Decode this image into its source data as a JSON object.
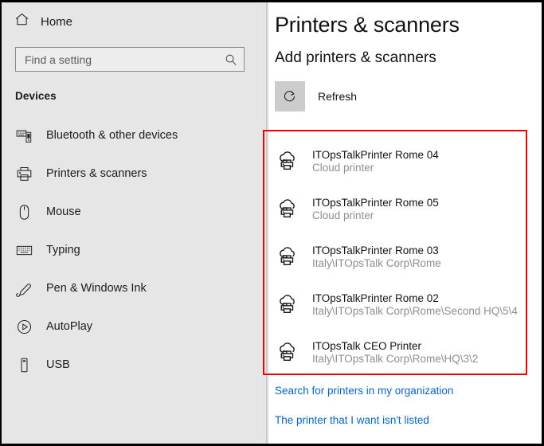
{
  "sidebar": {
    "home": {
      "label": "Home",
      "icon": "home-icon"
    },
    "search": {
      "value": "",
      "placeholder": "Find a setting",
      "icon": "search-icon"
    },
    "group_title": "Devices",
    "items": [
      {
        "label": "Bluetooth & other devices",
        "icon": "bluetooth-devices-icon"
      },
      {
        "label": "Printers & scanners",
        "icon": "printer-icon"
      },
      {
        "label": "Mouse",
        "icon": "mouse-icon"
      },
      {
        "label": "Typing",
        "icon": "keyboard-icon"
      },
      {
        "label": "Pen & Windows Ink",
        "icon": "pen-icon"
      },
      {
        "label": "AutoPlay",
        "icon": "autoplay-icon"
      },
      {
        "label": "USB",
        "icon": "usb-icon"
      }
    ]
  },
  "main": {
    "page_title": "Printers & scanners",
    "section_title": "Add printers & scanners",
    "refresh": {
      "label": "Refresh",
      "icon": "refresh-icon"
    },
    "printers": [
      {
        "name": "ITOpsTalkPrinter Rome 04",
        "sub": "Cloud printer",
        "icon": "cloud-printer-icon"
      },
      {
        "name": "ITOpsTalkPrinter Rome 05",
        "sub": "Cloud printer",
        "icon": "cloud-printer-icon"
      },
      {
        "name": "ITOpsTalkPrinter Rome 03",
        "sub": "Italy\\ITOpsTalk Corp\\Rome",
        "icon": "cloud-printer-icon"
      },
      {
        "name": "ITOpsTalkPrinter Rome 02",
        "sub": "Italy\\ITOpsTalk Corp\\Rome\\Second HQ\\5\\4",
        "icon": "cloud-printer-icon"
      },
      {
        "name": "ITOpsTalk CEO Printer",
        "sub": "Italy\\ITOpsTalk Corp\\Rome\\HQ\\3\\2",
        "icon": "cloud-printer-icon"
      }
    ],
    "links": [
      {
        "label": "Search for printers in my organization"
      },
      {
        "label": "The printer that I want isn't listed"
      }
    ]
  },
  "colors": {
    "highlight": "#ee0000",
    "link": "#0a64c8",
    "sidebar_bg": "#e6e6e6",
    "refresh_btn_bg": "#cccccc",
    "subtext": "#8f8f8f"
  }
}
